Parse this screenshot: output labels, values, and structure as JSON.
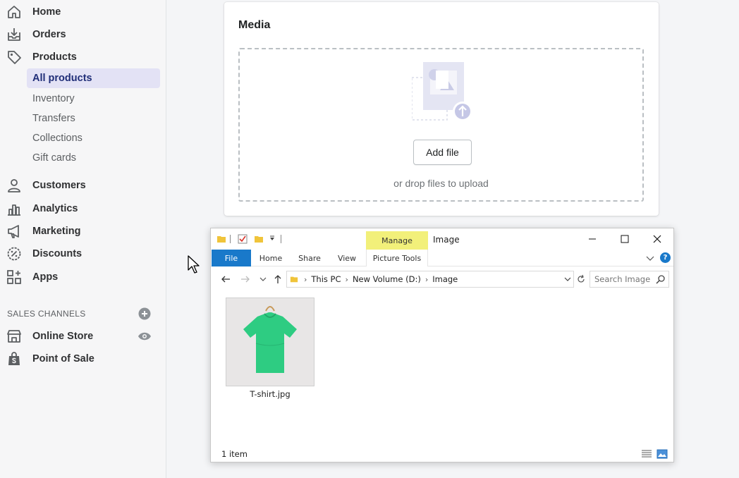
{
  "sidebar": {
    "nav": [
      {
        "label": "Home",
        "icon": "home-icon"
      },
      {
        "label": "Orders",
        "icon": "orders-icon"
      },
      {
        "label": "Products",
        "icon": "tag-icon"
      }
    ],
    "product_sub": [
      {
        "label": "All products",
        "active": true
      },
      {
        "label": "Inventory"
      },
      {
        "label": "Transfers"
      },
      {
        "label": "Collections"
      },
      {
        "label": "Gift cards"
      }
    ],
    "nav2": [
      {
        "label": "Customers",
        "icon": "person-icon"
      },
      {
        "label": "Analytics",
        "icon": "bar-chart-icon"
      },
      {
        "label": "Marketing",
        "icon": "megaphone-icon"
      },
      {
        "label": "Discounts",
        "icon": "discount-icon"
      },
      {
        "label": "Apps",
        "icon": "apps-icon"
      }
    ],
    "sales_channels_title": "SALES CHANNELS",
    "channels": [
      {
        "label": "Online Store",
        "icon": "store-icon"
      },
      {
        "label": "Point of Sale",
        "icon": "shopping-bag-icon"
      }
    ]
  },
  "media": {
    "title": "Media",
    "add_file_label": "Add file",
    "drop_hint": "or drop files to upload"
  },
  "explorer": {
    "manage_tab": "Manage",
    "window_title": "Image",
    "ribbon_tabs": [
      "File",
      "Home",
      "Share",
      "View",
      "Picture Tools"
    ],
    "breadcrumb": [
      "This PC",
      "New Volume (D:)",
      "Image"
    ],
    "search_placeholder": "Search Image",
    "files": [
      {
        "name": "T-shirt.jpg"
      }
    ],
    "status": "1 item"
  },
  "colors": {
    "accent": "#202e78",
    "active_bg": "#e3e2f5",
    "file_tab": "#1979ca",
    "manage_tab": "#f2f07a",
    "tshirt": "#2ecc82"
  }
}
